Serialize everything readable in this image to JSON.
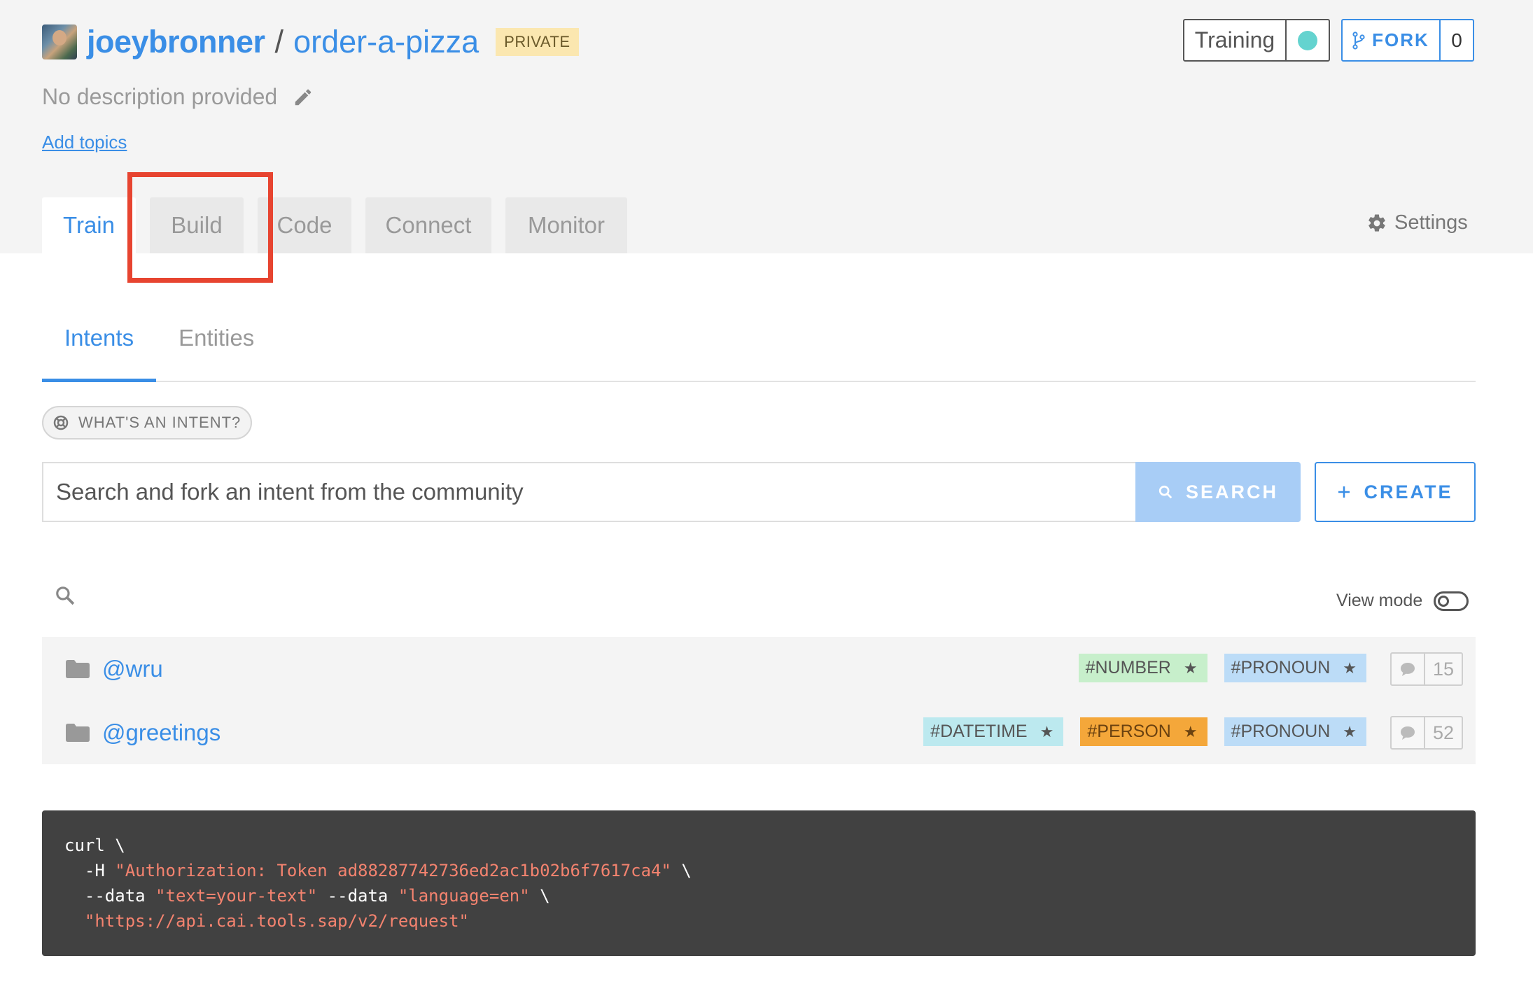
{
  "repo": {
    "owner": "joeybronner",
    "separator": "/",
    "name": "order-a-pizza",
    "visibility_badge": "PRIVATE",
    "description": "No description provided",
    "add_topics_label": "Add topics"
  },
  "status": {
    "training_label": "Training",
    "training_color": "#64d3cf"
  },
  "fork": {
    "label": "FORK",
    "count": "0"
  },
  "main_tabs": [
    {
      "label": "Train",
      "active": true
    },
    {
      "label": "Build",
      "active": false
    },
    {
      "label": "Code",
      "active": false
    },
    {
      "label": "Connect",
      "active": false
    },
    {
      "label": "Monitor",
      "active": false
    }
  ],
  "settings_label": "Settings",
  "highlight_color": "#e74430",
  "sub_tabs": [
    {
      "label": "Intents",
      "active": true
    },
    {
      "label": "Entities",
      "active": false
    }
  ],
  "whats_intent_label": "WHAT'S AN INTENT?",
  "search": {
    "placeholder": "Search and fork an intent from the community",
    "button_label": "SEARCH",
    "create_label": "CREATE"
  },
  "view_mode_label": "View mode",
  "intents": [
    {
      "name": "@wru",
      "entities": [
        {
          "label": "#NUMBER",
          "color": "green"
        },
        {
          "label": "#PRONOUN",
          "color": "blue"
        }
      ],
      "expression_count": "15"
    },
    {
      "name": "@greetings",
      "entities": [
        {
          "label": "#DATETIME",
          "color": "cyan"
        },
        {
          "label": "#PERSON",
          "color": "orange"
        },
        {
          "label": "#PRONOUN",
          "color": "blue"
        }
      ],
      "expression_count": "52"
    }
  ],
  "code": {
    "line1_cmd": "curl \\",
    "line2_flag": "  -H ",
    "line2_str": "\"Authorization: Token ad88287742736ed2ac1b02b6f7617ca4\"",
    "line2_end": " \\",
    "line3_flag1": "  --data ",
    "line3_str1": "\"text=your-text\"",
    "line3_flag2": " --data ",
    "line3_str2": "\"language=en\"",
    "line3_end": " \\",
    "line4_str": "  \"https://api.cai.tools.sap/v2/request\""
  },
  "colors": {
    "accent": "#3a8ee6",
    "header_bg": "#f4f4f4",
    "code_bg": "#414141",
    "code_string": "#f4836f"
  }
}
